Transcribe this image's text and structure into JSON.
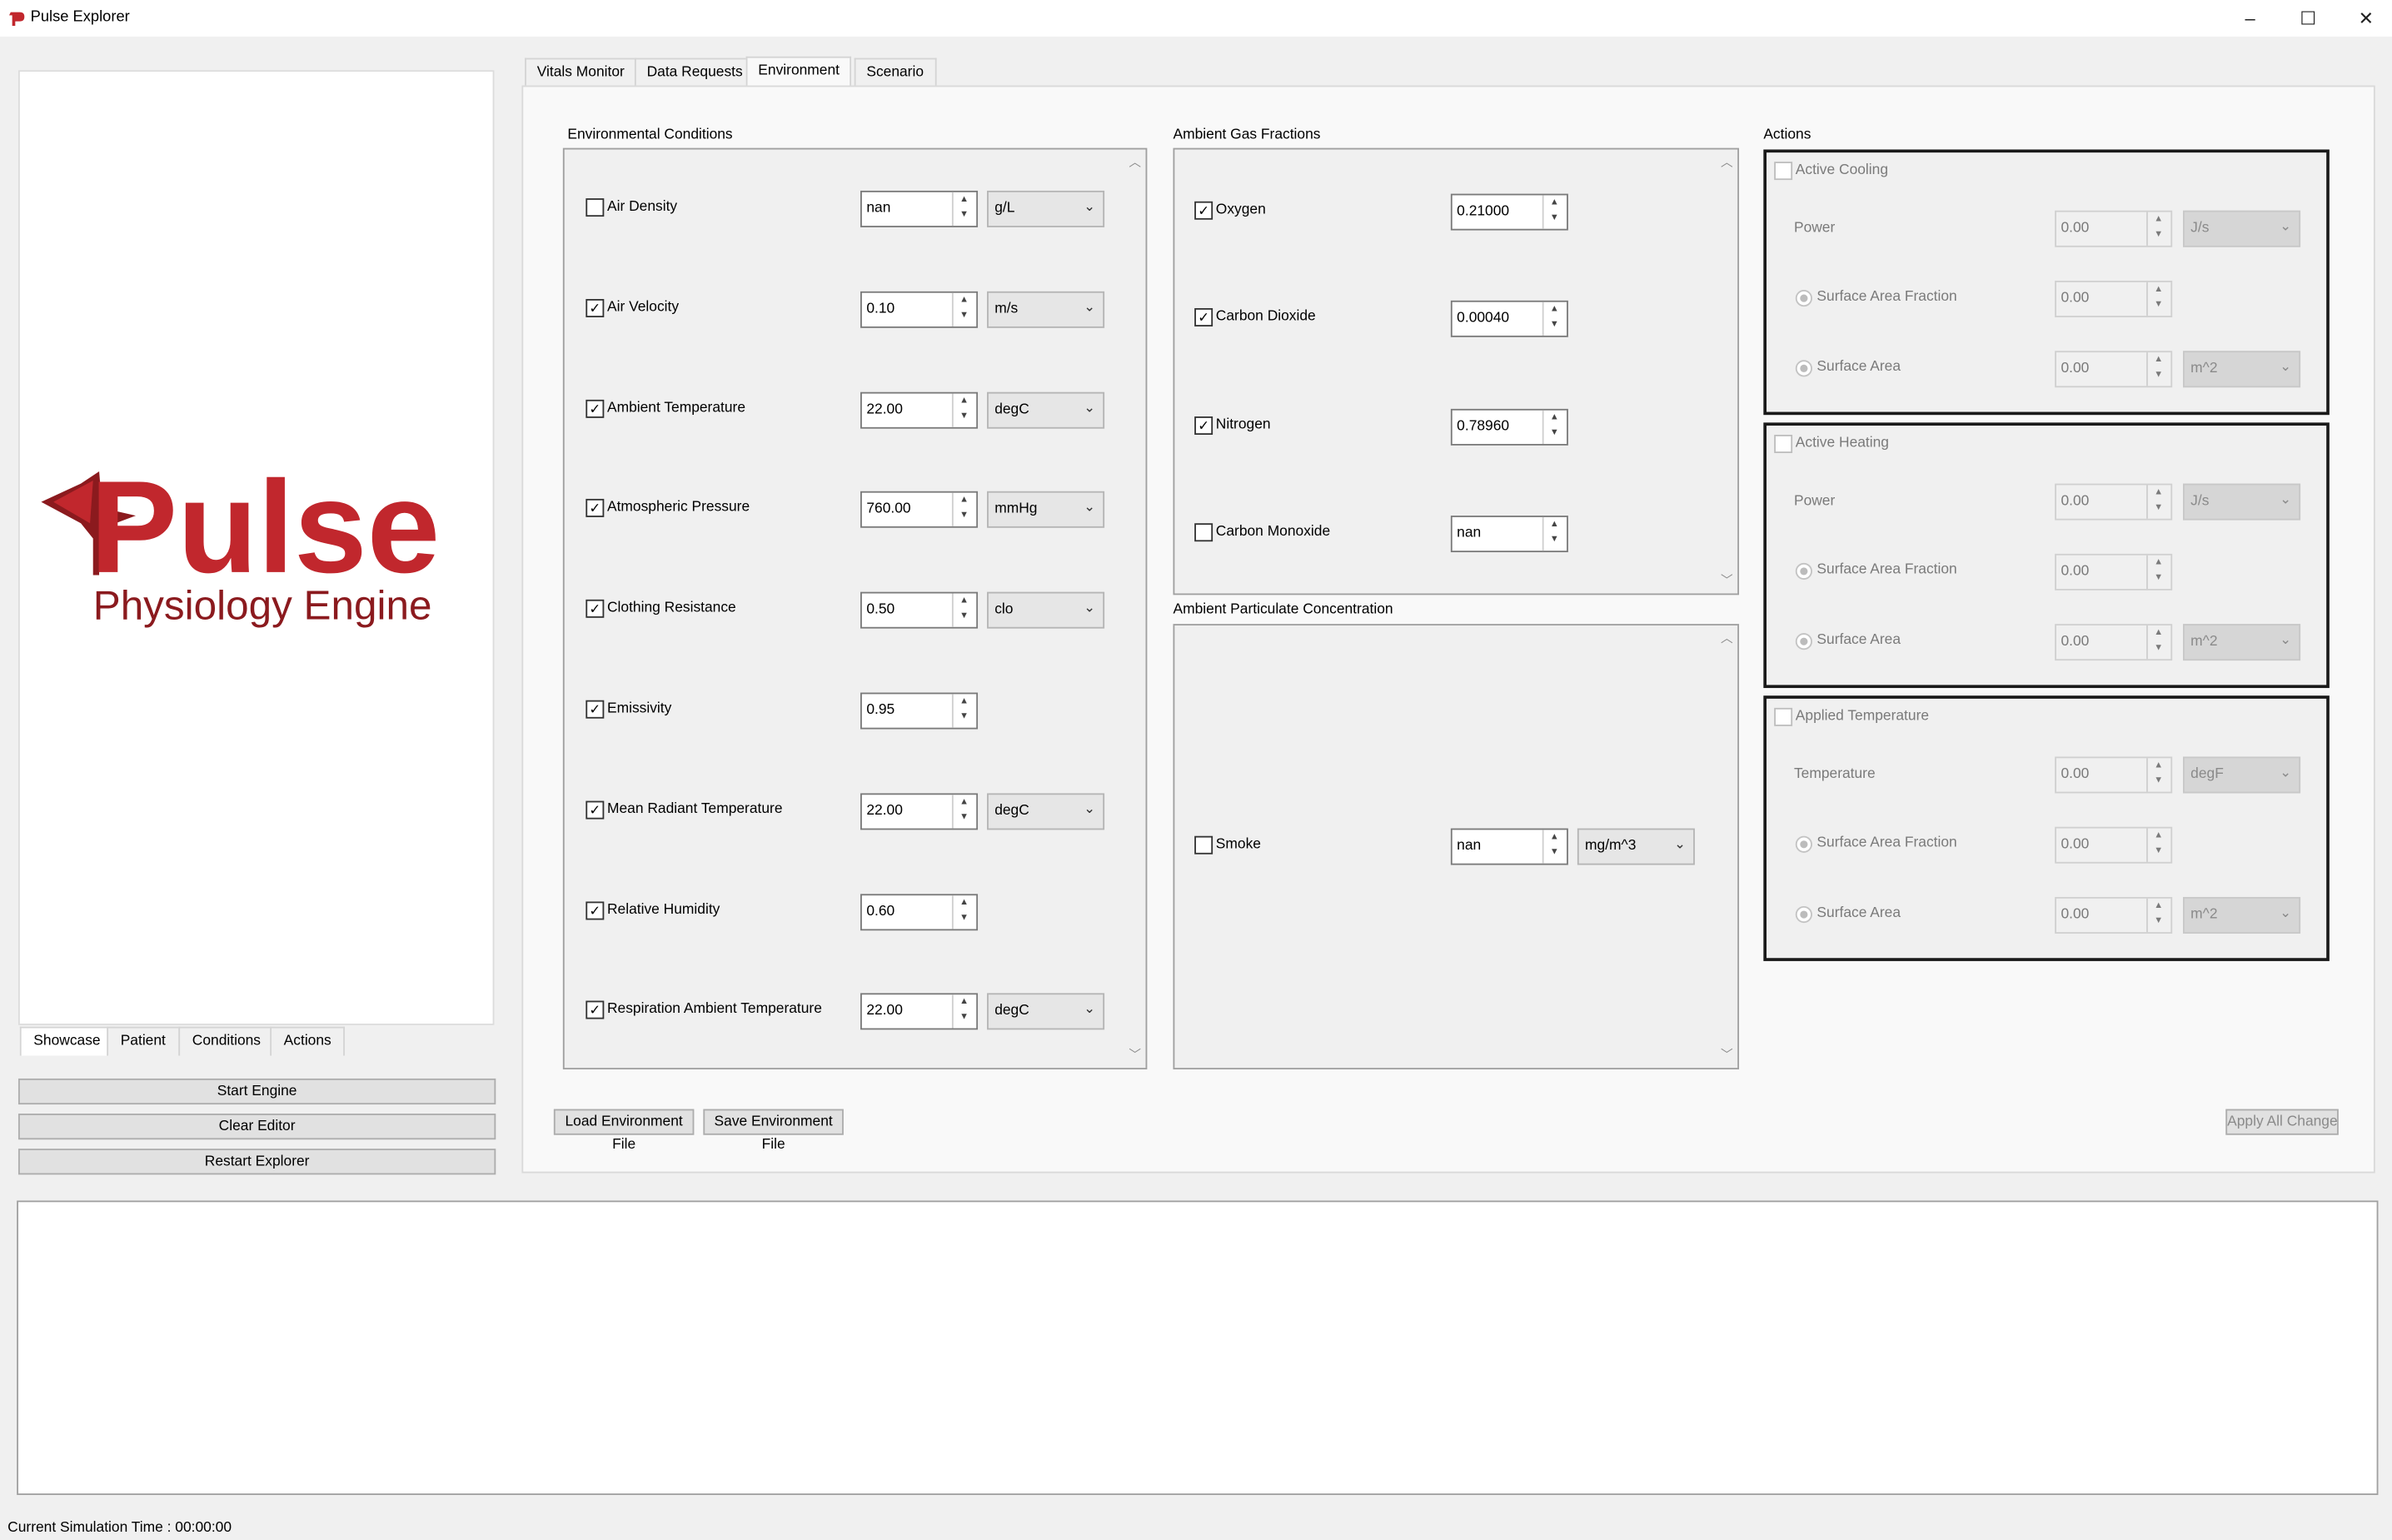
{
  "window": {
    "title": "Pulse Explorer",
    "buttons": [
      "–",
      "☐",
      "✕"
    ]
  },
  "logo": {
    "brand": "Pulse",
    "tagline": "Physiology Engine",
    "color": "#c1272d",
    "dark_color": "#8b1a1e"
  },
  "left_tabs": [
    "Showcase",
    "Patient",
    "Conditions",
    "Actions"
  ],
  "left_buttons": [
    "Start Engine",
    "Clear Editor",
    "Restart Explorer"
  ],
  "main_tabs": [
    "Vitals Monitor",
    "Data Requests",
    "Environment",
    "Scenario"
  ],
  "environmental_conditions": {
    "title": "Environmental Conditions",
    "rows": [
      {
        "label": "Air Density",
        "checked": false,
        "value": "nan",
        "unit": "g/L"
      },
      {
        "label": "Air Velocity",
        "checked": true,
        "value": "0.10",
        "unit": "m/s"
      },
      {
        "label": "Ambient Temperature",
        "checked": true,
        "value": "22.00",
        "unit": "degC"
      },
      {
        "label": "Atmospheric Pressure",
        "checked": true,
        "value": "760.00",
        "unit": "mmHg"
      },
      {
        "label": "Clothing Resistance",
        "checked": true,
        "value": "0.50",
        "unit": "clo"
      },
      {
        "label": "Emissivity",
        "checked": true,
        "value": "0.95",
        "unit": ""
      },
      {
        "label": "Mean Radiant Temperature",
        "checked": true,
        "value": "22.00",
        "unit": "degC"
      },
      {
        "label": "Relative Humidity",
        "checked": true,
        "value": "0.60",
        "unit": ""
      },
      {
        "label": "Respiration Ambient Temperature",
        "checked": true,
        "value": "22.00",
        "unit": "degC"
      }
    ]
  },
  "ambient_gas": {
    "title": "Ambient Gas Fractions",
    "rows": [
      {
        "label": "Oxygen",
        "checked": true,
        "value": "0.21000"
      },
      {
        "label": "Carbon Dioxide",
        "checked": true,
        "value": "0.00040"
      },
      {
        "label": "Nitrogen",
        "checked": true,
        "value": "0.78960"
      },
      {
        "label": "Carbon Monoxide",
        "checked": false,
        "value": "nan"
      }
    ]
  },
  "particulate": {
    "title": "Ambient Particulate Concentration",
    "rows": [
      {
        "label": "Smoke",
        "checked": false,
        "value": "nan",
        "unit": "mg/m^3"
      }
    ]
  },
  "actions": {
    "title": "Actions",
    "groups": [
      {
        "title": "Active Cooling",
        "first_label": "Power",
        "first_value": "0.00",
        "first_unit": "J/s",
        "saf_label": "Surface Area Fraction",
        "saf_value": "0.00",
        "sa_label": "Surface Area",
        "sa_value": "0.00",
        "sa_unit": "m^2"
      },
      {
        "title": "Active Heating",
        "first_label": "Power",
        "first_value": "0.00",
        "first_unit": "J/s",
        "saf_label": "Surface Area Fraction",
        "saf_value": "0.00",
        "sa_label": "Surface Area",
        "sa_value": "0.00",
        "sa_unit": "m^2"
      },
      {
        "title": "Applied Temperature",
        "first_label": "Temperature",
        "first_value": "0.00",
        "first_unit": "degF",
        "saf_label": "Surface Area Fraction",
        "saf_value": "0.00",
        "sa_label": "Surface Area",
        "sa_value": "0.00",
        "sa_unit": "m^2"
      }
    ]
  },
  "file_buttons": {
    "load": "Load Environment File",
    "save": "Save Environment File",
    "apply": "Apply All Changes"
  },
  "status": {
    "text": "Current Simulation Time : 00:00:00"
  }
}
